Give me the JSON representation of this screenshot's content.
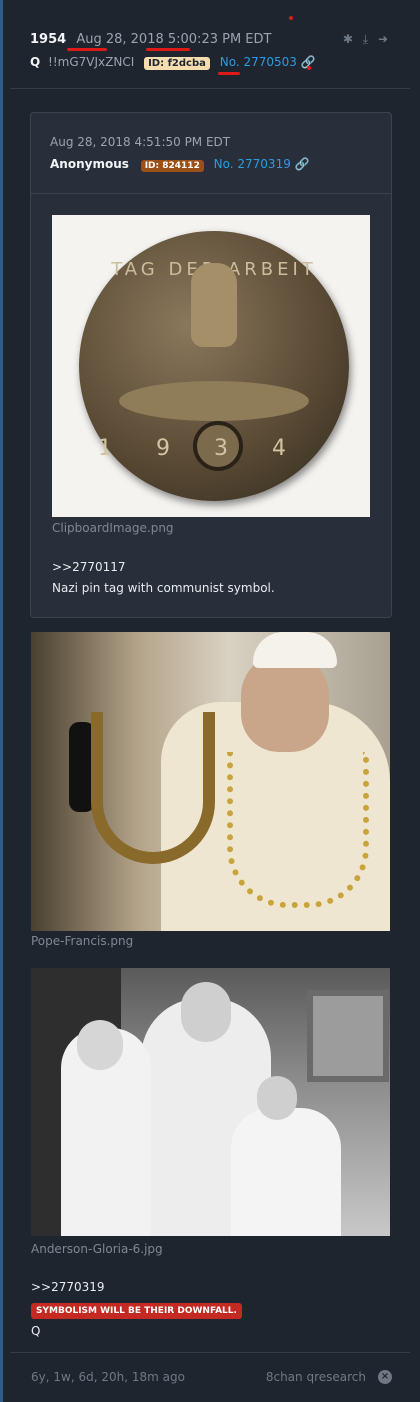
{
  "post": {
    "number": "1954",
    "date": "Aug 28, 2018 5:00:23 PM EDT",
    "author": "Q",
    "tripcode": "!!mG7VJxZNCI",
    "id_badge": "ID: f2dcba",
    "post_link": "No. 2770503",
    "link_icon": "🔗"
  },
  "header_icons": [
    "share-icon",
    "download-icon",
    "arrow-right-icon"
  ],
  "quoted": {
    "date": "Aug 28, 2018 4:51:50 PM EDT",
    "author": "Anonymous",
    "id_badge": "ID: 824112",
    "post_link": "No. 2770319",
    "image_filename": "ClipboardImage.png",
    "reply_ref": ">>2770117",
    "text": "Nazi pin tag with communist symbol.",
    "coin_text_top": "TAG DER ARBEIT",
    "coin_year": "1934"
  },
  "images": {
    "pope_filename": "Pope-Francis.png",
    "gloria_filename": "Anderson-Gloria-6.jpg"
  },
  "body": {
    "reply_ref": ">>2770319",
    "red_text": "SYMBOLISM WILL BE THEIR DOWNFALL.",
    "signature": "Q"
  },
  "footer": {
    "age": "6y, 1w, 6d, 20h, 18m ago",
    "source": "8chan qresearch",
    "close_glyph": "×"
  },
  "colors": {
    "background": "#1f252e",
    "link": "#2b9be4",
    "accent_bar": "#2f5c86",
    "red_marker": "#e01919"
  }
}
